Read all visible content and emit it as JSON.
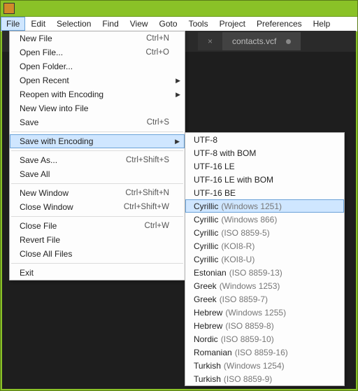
{
  "menubar": {
    "items": [
      {
        "label": "File",
        "active": true
      },
      {
        "label": "Edit"
      },
      {
        "label": "Selection"
      },
      {
        "label": "Find"
      },
      {
        "label": "View"
      },
      {
        "label": "Goto"
      },
      {
        "label": "Tools"
      },
      {
        "label": "Project"
      },
      {
        "label": "Preferences"
      },
      {
        "label": "Help"
      }
    ]
  },
  "tabs": [
    {
      "label": "",
      "inactive": true
    },
    {
      "label": "contacts.vcf",
      "active": true,
      "dirty": true
    }
  ],
  "file_menu": [
    {
      "label": "New File",
      "shortcut": "Ctrl+N"
    },
    {
      "label": "Open File...",
      "shortcut": "Ctrl+O"
    },
    {
      "label": "Open Folder..."
    },
    {
      "label": "Open Recent",
      "submenu": true
    },
    {
      "label": "Reopen with Encoding",
      "submenu": true
    },
    {
      "label": "New View into File"
    },
    {
      "label": "Save",
      "shortcut": "Ctrl+S"
    },
    {
      "sep": true
    },
    {
      "label": "Save with Encoding",
      "submenu": true,
      "highlight": true
    },
    {
      "sep": true
    },
    {
      "label": "Save As...",
      "shortcut": "Ctrl+Shift+S"
    },
    {
      "label": "Save All"
    },
    {
      "sep": true
    },
    {
      "label": "New Window",
      "shortcut": "Ctrl+Shift+N"
    },
    {
      "label": "Close Window",
      "shortcut": "Ctrl+Shift+W"
    },
    {
      "sep": true
    },
    {
      "label": "Close File",
      "shortcut": "Ctrl+W"
    },
    {
      "label": "Revert File"
    },
    {
      "label": "Close All Files"
    },
    {
      "sep": true
    },
    {
      "label": "Exit"
    }
  ],
  "encoding_menu": [
    {
      "label": "UTF-8"
    },
    {
      "label": "UTF-8 with BOM"
    },
    {
      "label": "UTF-16 LE"
    },
    {
      "label": "UTF-16 LE with BOM"
    },
    {
      "label": "UTF-16 BE"
    },
    {
      "label": "Cyrillic",
      "dim": "(Windows 1251)",
      "highlight": true
    },
    {
      "label": "Cyrillic",
      "dim": "(Windows 866)"
    },
    {
      "label": "Cyrillic",
      "dim": "(ISO 8859-5)"
    },
    {
      "label": "Cyrillic",
      "dim": "(KOI8-R)"
    },
    {
      "label": "Cyrillic",
      "dim": "(KOI8-U)"
    },
    {
      "label": "Estonian",
      "dim": "(ISO 8859-13)"
    },
    {
      "label": "Greek",
      "dim": "(Windows 1253)"
    },
    {
      "label": "Greek",
      "dim": "(ISO 8859-7)"
    },
    {
      "label": "Hebrew",
      "dim": "(Windows 1255)"
    },
    {
      "label": "Hebrew",
      "dim": "(ISO 8859-8)"
    },
    {
      "label": "Nordic",
      "dim": "(ISO 8859-10)"
    },
    {
      "label": "Romanian",
      "dim": "(ISO 8859-16)"
    },
    {
      "label": "Turkish",
      "dim": "(Windows 1254)"
    },
    {
      "label": "Turkish",
      "dim": "(ISO 8859-9)"
    }
  ]
}
